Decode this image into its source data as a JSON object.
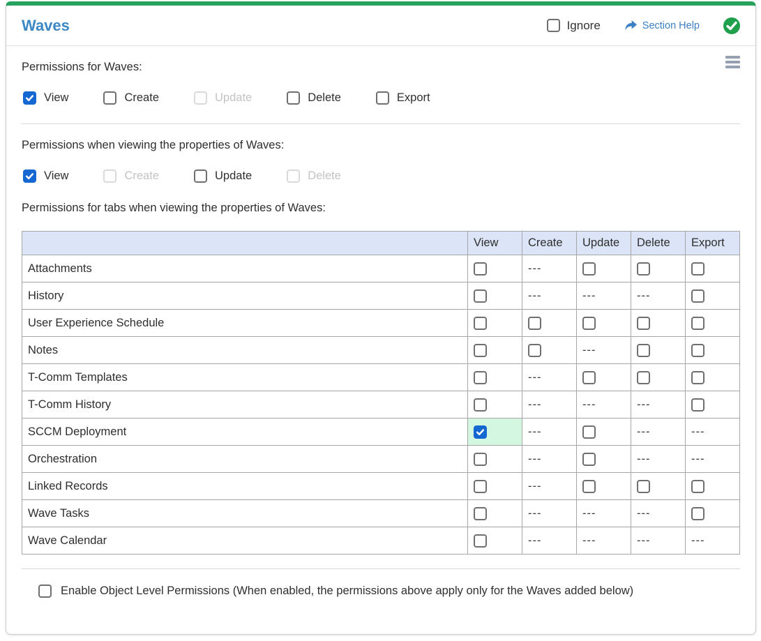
{
  "colors": {
    "accent_green": "#27a35f",
    "title_blue": "#3b88c4",
    "link_blue": "#3b7fc4",
    "status_green": "#1ea04c",
    "checkbox_blue": "#1567d2",
    "table_header_bg": "#dce5f7",
    "highlight_green": "#d4f7e1"
  },
  "header": {
    "title": "Waves",
    "ignore_label": "Ignore",
    "section_help_label": "Section Help"
  },
  "sections": [
    {
      "label": "Permissions for Waves:",
      "checkboxes": [
        {
          "label": "View",
          "state": "checked"
        },
        {
          "label": "Create",
          "state": "unchecked"
        },
        {
          "label": "Update",
          "state": "disabled"
        },
        {
          "label": "Delete",
          "state": "unchecked"
        },
        {
          "label": "Export",
          "state": "unchecked"
        }
      ]
    },
    {
      "label": "Permissions when viewing the properties of Waves:",
      "checkboxes": [
        {
          "label": "View",
          "state": "checked"
        },
        {
          "label": "Create",
          "state": "disabled"
        },
        {
          "label": "Update",
          "state": "unchecked"
        },
        {
          "label": "Delete",
          "state": "disabled"
        }
      ]
    }
  ],
  "table_section_label": "Permissions for tabs when viewing the properties of Waves:",
  "permissions_table": {
    "columns": [
      "",
      "View",
      "Create",
      "Update",
      "Delete",
      "Export"
    ],
    "na_text": "---",
    "rows": [
      {
        "label": "Attachments",
        "cells": [
          "unchecked",
          "na",
          "unchecked",
          "unchecked",
          "unchecked"
        ]
      },
      {
        "label": "History",
        "cells": [
          "unchecked",
          "na",
          "na",
          "na",
          "unchecked"
        ]
      },
      {
        "label": "User Experience Schedule",
        "cells": [
          "unchecked",
          "unchecked",
          "unchecked",
          "unchecked",
          "unchecked"
        ]
      },
      {
        "label": "Notes",
        "cells": [
          "unchecked",
          "unchecked",
          "na",
          "unchecked",
          "unchecked"
        ]
      },
      {
        "label": "T-Comm Templates",
        "cells": [
          "unchecked",
          "na",
          "unchecked",
          "unchecked",
          "unchecked"
        ]
      },
      {
        "label": "T-Comm History",
        "cells": [
          "unchecked",
          "na",
          "na",
          "na",
          "unchecked"
        ]
      },
      {
        "label": "SCCM Deployment",
        "cells": [
          "checked-highlight",
          "na",
          "unchecked",
          "na",
          "na"
        ]
      },
      {
        "label": "Orchestration",
        "cells": [
          "unchecked",
          "na",
          "unchecked",
          "na",
          "na"
        ]
      },
      {
        "label": "Linked Records",
        "cells": [
          "unchecked",
          "na",
          "unchecked",
          "unchecked",
          "unchecked"
        ]
      },
      {
        "label": "Wave Tasks",
        "cells": [
          "unchecked",
          "na",
          "na",
          "na",
          "unchecked"
        ]
      },
      {
        "label": "Wave Calendar",
        "cells": [
          "unchecked",
          "na",
          "na",
          "na",
          "na"
        ]
      }
    ]
  },
  "footer": {
    "enable_olp_label": "Enable Object Level Permissions (When enabled, the permissions above apply only for the Waves added below)",
    "enable_olp_state": "unchecked"
  }
}
